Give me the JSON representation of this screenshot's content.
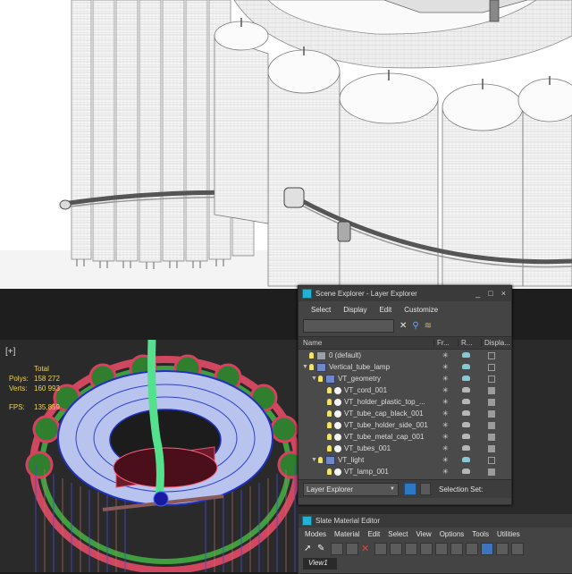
{
  "viewport": {
    "label": "[+]",
    "stats": {
      "total_header": "Total",
      "polys_label": "Polys:",
      "polys_value": "158 272",
      "verts_label": "Verts:",
      "verts_value": "160 993",
      "fps_label": "FPS:",
      "fps_value": "135,859"
    }
  },
  "scene_explorer": {
    "title": "Scene Explorer - Layer Explorer",
    "window_buttons": [
      "_",
      "□",
      "×"
    ],
    "menu": [
      "Select",
      "Display",
      "Edit",
      "Customize"
    ],
    "columns": [
      "Name",
      "Fr...",
      "R...",
      "Displa..."
    ],
    "rows": [
      {
        "name": "0 (default)",
        "depth": 0,
        "icon": "layer-gray",
        "expand": ""
      },
      {
        "name": "Vertical_tube_lamp",
        "depth": 0,
        "icon": "layer",
        "expand": "▼"
      },
      {
        "name": "VT_geometry",
        "depth": 1,
        "icon": "layer",
        "expand": "▼"
      },
      {
        "name": "VT_cord_001",
        "depth": 2,
        "icon": "sphere",
        "expand": ""
      },
      {
        "name": "VT_holder_plastic_top_...",
        "depth": 2,
        "icon": "sphere",
        "expand": ""
      },
      {
        "name": "VT_tube_cap_black_001",
        "depth": 2,
        "icon": "sphere",
        "expand": ""
      },
      {
        "name": "VT_tube_holder_side_001",
        "depth": 2,
        "icon": "sphere",
        "expand": ""
      },
      {
        "name": "VT_tube_metal_cap_001",
        "depth": 2,
        "icon": "sphere",
        "expand": ""
      },
      {
        "name": "VT_tubes_001",
        "depth": 2,
        "icon": "sphere",
        "expand": ""
      },
      {
        "name": "VT_light",
        "depth": 1,
        "icon": "layer",
        "expand": "▼"
      },
      {
        "name": "VT_lamp_001",
        "depth": 2,
        "icon": "sphere",
        "expand": ""
      }
    ],
    "footer": {
      "dropdown": "Layer Explorer",
      "selection_set_label": "Selection Set:"
    }
  },
  "slate": {
    "title": "Slate Material Editor",
    "menu": [
      "Modes",
      "Material",
      "Edit",
      "Select",
      "View",
      "Options",
      "Tools",
      "Utilities"
    ],
    "tab": "View1"
  },
  "colors": {
    "stats_text": "#f0d44a",
    "accent": "#26b0d4",
    "panel_bg": "#444444"
  }
}
